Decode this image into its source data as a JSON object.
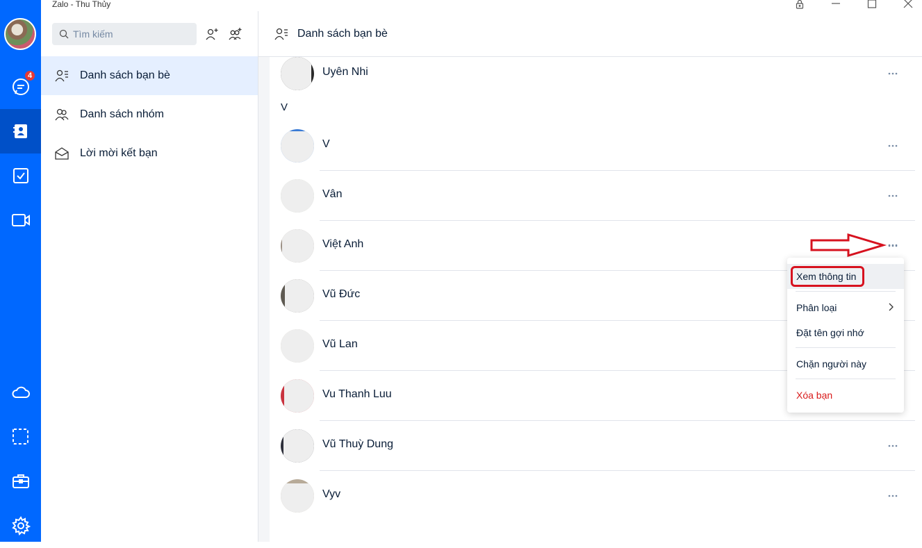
{
  "window": {
    "title": "Zalo - Thu Thủy"
  },
  "rail": {
    "chat_badge": "4"
  },
  "search": {
    "placeholder": "Tìm kiếm"
  },
  "sidebar": {
    "items": [
      {
        "label": "Danh sách bạn bè"
      },
      {
        "label": "Danh sách nhóm"
      },
      {
        "label": "Lời mời kết bạn"
      }
    ]
  },
  "header": {
    "title": "Danh sách bạn bè"
  },
  "contacts": {
    "section_letter": "V",
    "rows": [
      {
        "name": "Uyên Nhi"
      },
      {
        "name": "V"
      },
      {
        "name": "Vân"
      },
      {
        "name": "Việt Anh"
      },
      {
        "name": "Vũ Đức"
      },
      {
        "name": "Vũ Lan"
      },
      {
        "name": "Vu Thanh Luu"
      },
      {
        "name": "Vũ Thuỳ Dung"
      },
      {
        "name": "Vyv"
      }
    ]
  },
  "context_menu": {
    "view_info": "Xem thông tin",
    "classify": "Phân loại",
    "set_nickname": "Đặt tên gợi nhớ",
    "block": "Chặn người này",
    "remove_friend": "Xóa bạn"
  },
  "colors": {
    "accent": "#0068ff",
    "active_bg": "#e5efff",
    "danger": "#d91b1b",
    "annotation": "#d7121f"
  }
}
